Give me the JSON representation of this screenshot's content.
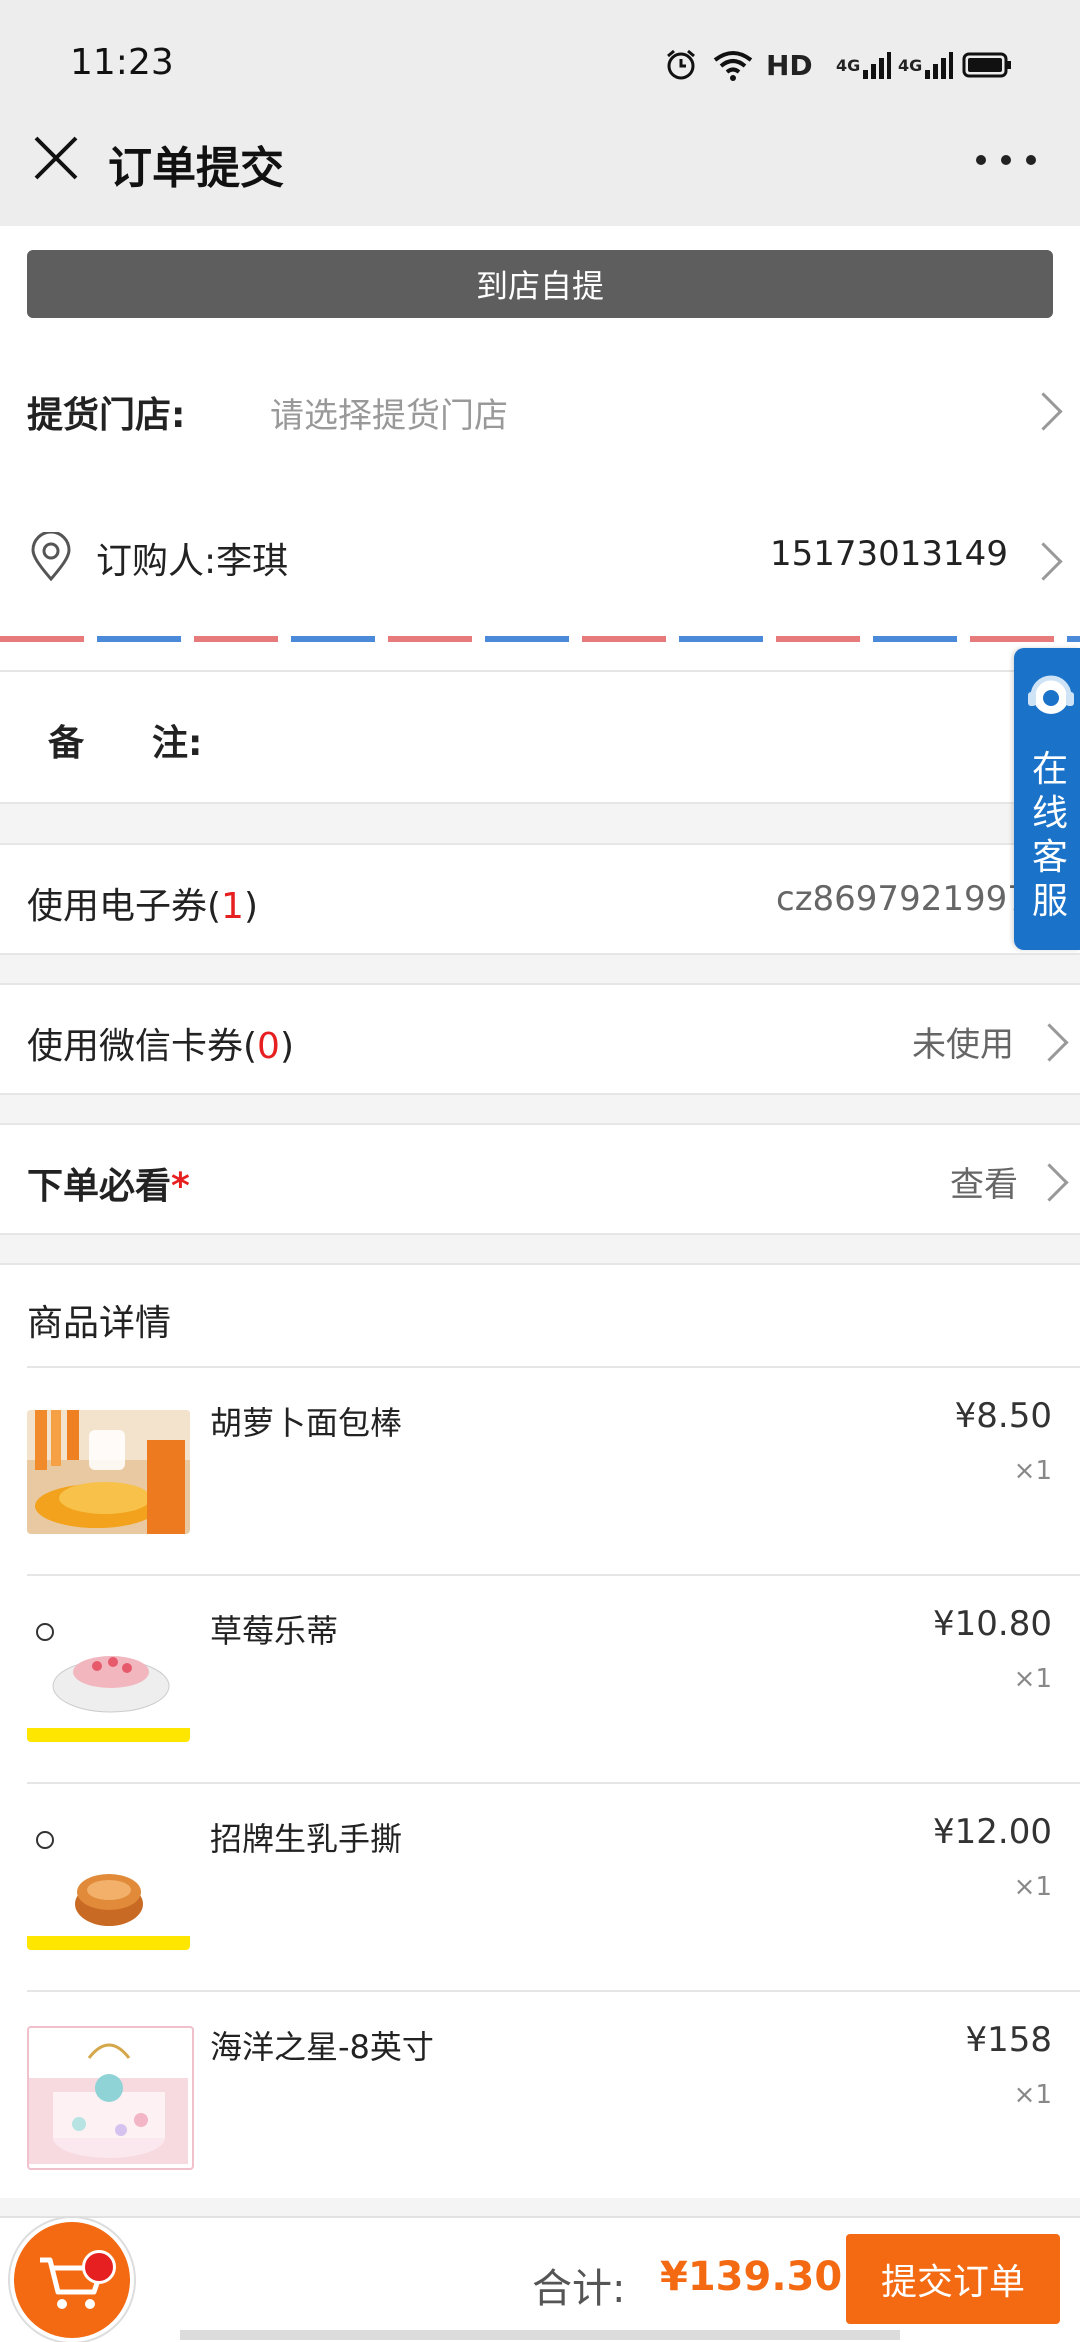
{
  "status_bar": {
    "time": "11:23",
    "network_label": "HD",
    "signal_1": "4G",
    "signal_2": "4G"
  },
  "header": {
    "title": "订单提交"
  },
  "pickup_button": "到店自提",
  "store": {
    "label": "提货门店:",
    "placeholder": "请选择提货门店"
  },
  "buyer": {
    "label": "订购人:李琪",
    "phone": "15173013149"
  },
  "remark": {
    "label_1": "备",
    "label_2": "注:"
  },
  "coupon": {
    "label": "使用电子券(",
    "count": "1",
    "label_end": ")",
    "value": "cz8697921997"
  },
  "wechat_card": {
    "label": "使用微信卡券(",
    "count": "0",
    "label_end": ")",
    "value": "未使用"
  },
  "must_read": {
    "label": "下单必看",
    "star": "*",
    "value": "查看"
  },
  "goods": {
    "title": "商品详情",
    "items": [
      {
        "name": "胡萝卜面包棒",
        "price": "¥8.50",
        "qty": "×1"
      },
      {
        "name": "草莓乐蒂",
        "price": "¥10.80",
        "qty": "×1"
      },
      {
        "name": "招牌生乳手撕",
        "price": "¥12.00",
        "qty": "×1"
      },
      {
        "name": "海洋之星-8英寸",
        "price": "¥158",
        "qty": "×1"
      }
    ]
  },
  "service": {
    "label": "在线客服"
  },
  "footer": {
    "total_label": "合计:",
    "total_value": "¥139.30",
    "submit": "提交订单"
  },
  "colors": {
    "accent": "#f36a12",
    "red": "#e62020",
    "service_blue": "#1a73c8"
  }
}
